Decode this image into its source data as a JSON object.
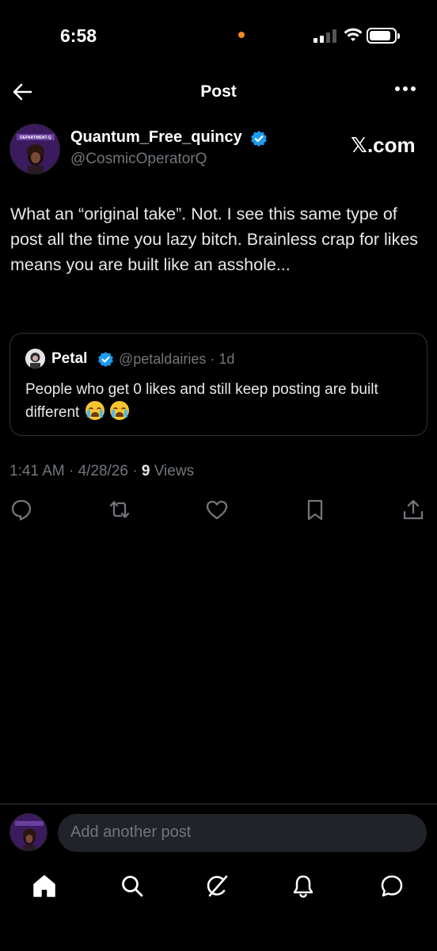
{
  "status_bar": {
    "time": "6:58"
  },
  "header": {
    "title": "Post"
  },
  "post": {
    "author_name": "Quantum_Free_quincy",
    "author_handle": "@CosmicOperatorQ",
    "watermark": "𝕏.com",
    "text": "What an “original take”. Not. I see this same type of post all the time you lazy bitch. Brainless crap for likes means you are built like an asshole...",
    "timestamp": "1:41 AM · 4/28/26 · ",
    "views_count": "9",
    "views_label": " Views",
    "avatar_logo_text": "DEPARTMENT-Q"
  },
  "quoted_post": {
    "author_name": "Petal",
    "author_handle": "@petaldairies",
    "age": " · 1d",
    "text": "People who get 0 likes and still keep posting are built different "
  },
  "composer": {
    "placeholder": "Add another post"
  },
  "colors": {
    "background": "#000000",
    "accent": "#1d9bf0",
    "muted": "#71767b",
    "status_dot": "#f08a24"
  }
}
